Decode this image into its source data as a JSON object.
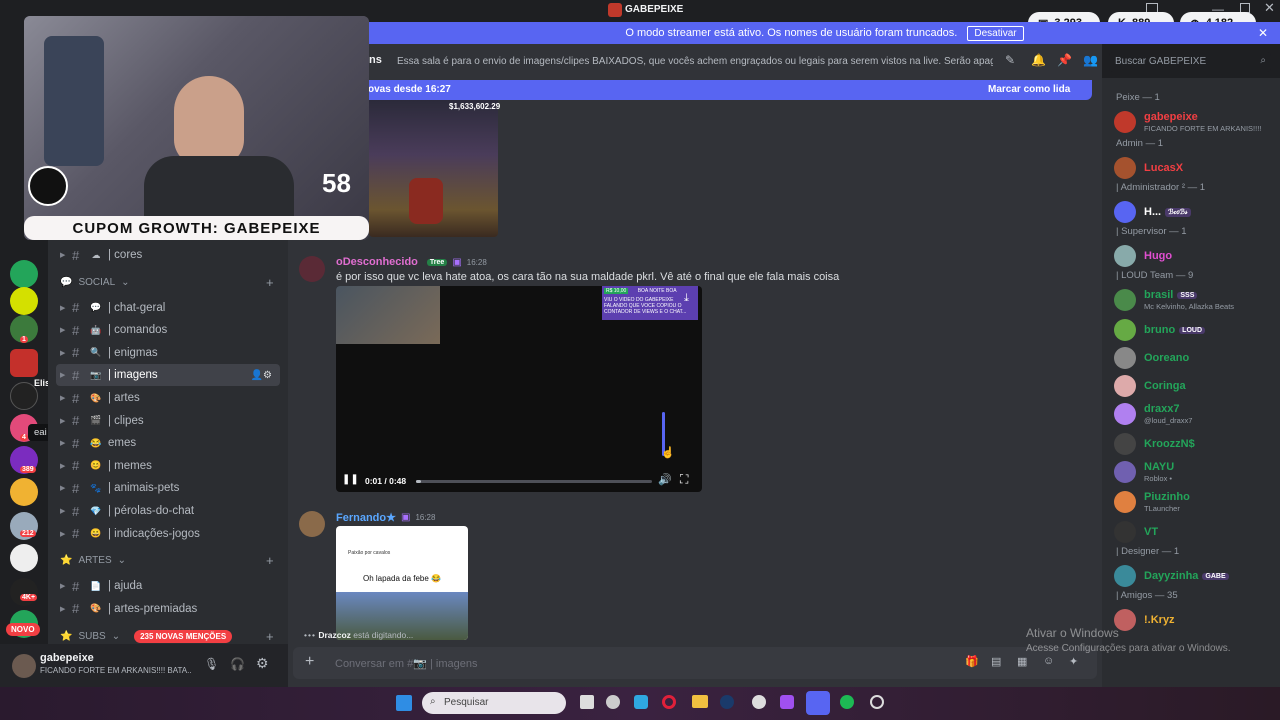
{
  "window": {
    "title": "GABEPEIXE"
  },
  "stats": [
    {
      "icon": "chat-icon",
      "value": "3.293"
    },
    {
      "icon": "kick-icon",
      "value": "889"
    },
    {
      "icon": "globe-icon",
      "value": "4.182"
    }
  ],
  "streamer_banner": {
    "text": "O modo streamer está ativo. Os nomes de usuário foram truncados.",
    "button": "Desativar"
  },
  "header": {
    "channel_partial": "ns",
    "topic": "Essa sala é para o envio de imagens/clipes BAIXADOS, que vocês achem engraçados ou legais para serem vistos na live. Serão apagados prints de o...",
    "search_placeholder": "Buscar GABEPEIXE"
  },
  "new_messages_bar": {
    "text": "ovas desde 16:27",
    "mark_read": "Marcar como lida"
  },
  "webcam": {
    "coupon": "CUPOM GROWTH: GABEPEIXE",
    "overlay_number": "58"
  },
  "guild_badges": [
    "1",
    "4",
    "389",
    "212",
    "4K+"
  ],
  "guild_new_label": "NOVO",
  "tooltip_user": "EliseuJr55",
  "tooltip": "eai GabedoPeixe",
  "channels": [
    {
      "type": "channel",
      "emoji": "☁",
      "name": "| cores"
    },
    {
      "type": "category",
      "emoji": "💬",
      "name": "SOCIAL"
    },
    {
      "type": "channel",
      "emoji": "💬",
      "name": "| chat-geral"
    },
    {
      "type": "channel",
      "emoji": "🤖",
      "name": "| comandos"
    },
    {
      "type": "channel",
      "emoji": "🔍",
      "name": "| enigmas"
    },
    {
      "type": "channel",
      "emoji": "📷",
      "name": "| imagens",
      "active": true
    },
    {
      "type": "channel",
      "emoji": "🎨",
      "name": "| artes"
    },
    {
      "type": "channel",
      "emoji": "🎬",
      "name": "| clipes"
    },
    {
      "type": "channel",
      "emoji": "😂",
      "name": "emes"
    },
    {
      "type": "channel",
      "emoji": "😊",
      "name": "| memes"
    },
    {
      "type": "channel",
      "emoji": "🐾",
      "name": "| animais-pets"
    },
    {
      "type": "channel",
      "emoji": "💎",
      "name": "| pérolas-do-chat"
    },
    {
      "type": "channel",
      "emoji": "😀",
      "name": "| indicações-jogos"
    },
    {
      "type": "category",
      "emoji": "⭐",
      "name": "ARTES"
    },
    {
      "type": "channel",
      "emoji": "📄",
      "name": "| ajuda"
    },
    {
      "type": "channel",
      "emoji": "🎨",
      "name": "| artes-premiadas"
    },
    {
      "type": "category",
      "emoji": "⭐",
      "name": "SUBS",
      "badge": "235 NOVAS MENÇÕES"
    }
  ],
  "user_panel": {
    "name": "gabepeixe",
    "status": "FICANDO FORTE EM ARKANIS!!!! BATA..."
  },
  "messages": [
    {
      "author": "oDesconhecido",
      "badge": "Tree",
      "time": "16:28",
      "text": "é por isso que vc leva hate atoa,  os cara tão na sua maldade pkrl. Vê até o final que ele fala mais coisa",
      "video": {
        "time": "0:01 / 0:48",
        "progress": 0.02,
        "caption_top": "VIU O VIDEO DO GABEPEIXE FALANDO QUE VOCE COPIOU O CONTADOR DE VIEWS E O CHAT...",
        "caption_tag": "R$ 10,00",
        "caption_tag2": "BOA NOITE BOA"
      }
    },
    {
      "author": "Fernando★",
      "time": "16:28",
      "image_caption": "Oh lapada da febe 😂",
      "image_header": "Paixão por cavalos"
    }
  ],
  "top_image": {
    "amount": "$1,633,602.29"
  },
  "typing": {
    "text": "está digitando..."
  },
  "composer": {
    "placeholder": "Conversar em #📷 | imagens"
  },
  "members": [
    {
      "type": "role",
      "name": "Peixe — 1"
    },
    {
      "type": "member",
      "name": "gabepeixe",
      "sub": "FICANDO FORTE EM ARKANIS!!!!",
      "color": "#f23f43"
    },
    {
      "type": "role",
      "name": "Admin — 1"
    },
    {
      "type": "member",
      "name": "LucasX",
      "color": "#f23f43"
    },
    {
      "type": "role",
      "name": "| Administrador ² — 1"
    },
    {
      "type": "member",
      "name": "H...",
      "tag": "ℬ𝒸𝑜ℬ𝓈",
      "color": "#ffffff"
    },
    {
      "type": "role",
      "name": "| Supervisor — 1"
    },
    {
      "type": "member",
      "name": "Hugo",
      "color": "#e04fd0"
    },
    {
      "type": "role",
      "name": "| LOUD Team — 9"
    },
    {
      "type": "member",
      "name": "brasil",
      "tag": "SSS",
      "sub": "Mc Kelvinho, Allazka Beats",
      "color": "#23a55a"
    },
    {
      "type": "member",
      "name": "bruno",
      "tag": "LOUD",
      "color": "#23a55a"
    },
    {
      "type": "member",
      "name": "Ooreano",
      "color": "#23a55a"
    },
    {
      "type": "member",
      "name": "Coringa",
      "color": "#23a55a"
    },
    {
      "type": "member",
      "name": "draxx7",
      "sub": "@loud_draxx7",
      "color": "#23a55a"
    },
    {
      "type": "member",
      "name": "KroozzN$",
      "color": "#23a55a"
    },
    {
      "type": "member",
      "name": "NAYU",
      "sub": "Roblox •",
      "color": "#23a55a"
    },
    {
      "type": "member",
      "name": "Piuzinho",
      "sub": "TLauncher",
      "color": "#23a55a"
    },
    {
      "type": "member",
      "name": "VT",
      "color": "#23a55a"
    },
    {
      "type": "role",
      "name": "| Designer — 1"
    },
    {
      "type": "member",
      "name": "Dayyzinha",
      "tag": "GABE",
      "color": "#23a55a"
    },
    {
      "type": "role",
      "name": "| Amigos — 35"
    },
    {
      "type": "member",
      "name": "!.Kryz",
      "color": "#f0b232"
    }
  ],
  "windows_watermark": {
    "line1": "Ativar o Windows",
    "line2": "Acesse Configurações para ativar o Windows."
  },
  "taskbar": {
    "search": "Pesquisar"
  }
}
